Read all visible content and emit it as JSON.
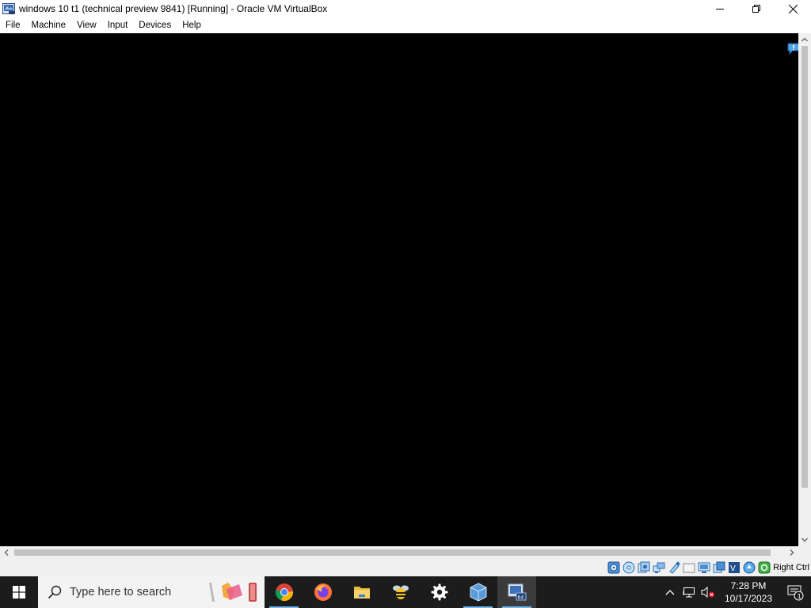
{
  "window": {
    "title": "windows 10 t1 (technical preview 9841) [Running] - Oracle VM VirtualBox",
    "app_icon": "virtualbox-vm-icon",
    "controls": [
      "minimize-icon",
      "maximize-icon",
      "close-icon"
    ]
  },
  "menu": {
    "items": [
      {
        "label": "File"
      },
      {
        "label": "Machine"
      },
      {
        "label": "View"
      },
      {
        "label": "Input"
      },
      {
        "label": "Devices"
      },
      {
        "label": "Help"
      }
    ]
  },
  "vm_display": {
    "background": "#000000",
    "notification_icon": "message-bubble-icon"
  },
  "statusbar": {
    "icons": [
      "hard-disk-icon",
      "optical-drive-icon",
      "audio-icon",
      "network-icon",
      "usb-icon",
      "shared-folders-icon",
      "display-icon",
      "video-capture-icon",
      "virtualization-icon",
      "mouse-integration-icon",
      "keyboard-capture-icon"
    ],
    "host_key": "Right Ctrl"
  },
  "taskbar": {
    "search_placeholder": "Type here to search",
    "apps": [
      {
        "name": "chrome",
        "icon": "chrome-icon",
        "active": true
      },
      {
        "name": "firefox",
        "icon": "firefox-icon",
        "active": false
      },
      {
        "name": "file-explorer",
        "icon": "folder-icon",
        "active": false
      },
      {
        "name": "bee-app",
        "icon": "bee-icon",
        "active": false
      },
      {
        "name": "settings",
        "icon": "gear-icon",
        "active": false
      },
      {
        "name": "virtualbox",
        "icon": "virtualbox-icon",
        "active": true
      },
      {
        "name": "virtualbox-vm",
        "icon": "virtualbox-vm-icon",
        "active": true
      }
    ],
    "tray_icons": [
      "chevron-up-icon",
      "network-icon",
      "speaker-muted-icon"
    ],
    "clock": {
      "time": "7:28 PM",
      "date": "10/17/2023"
    },
    "notification_count": "1"
  }
}
